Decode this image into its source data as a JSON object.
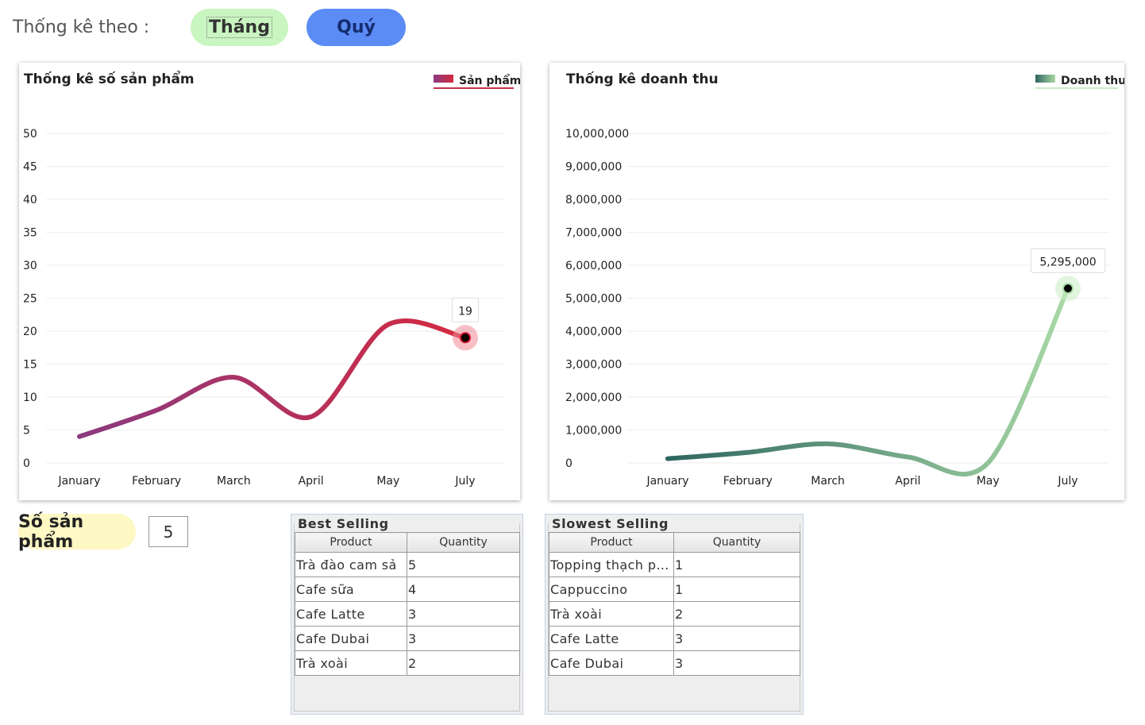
{
  "filter": {
    "label": "Thống kê theo :",
    "month_button": "Tháng",
    "quarter_button": "Quý"
  },
  "colors": {
    "month_button_bg": "#c9f5c0",
    "quarter_button_bg": "#5b8cf5",
    "products_line_start": "#8b3a80",
    "products_line_end": "#d42a40",
    "revenue_line_start": "#2e6660",
    "revenue_line_end": "#a9d9a6",
    "qty_pill_bg": "#fdf8c4"
  },
  "chart_data": [
    {
      "type": "line",
      "title": "Thống kê số sản phẩm",
      "legend": "Sản phẩm",
      "legend_position": "top-right",
      "categories": [
        "January",
        "February",
        "March",
        "April",
        "May",
        "July"
      ],
      "values": [
        4,
        8,
        13,
        7,
        21,
        19
      ],
      "highlight": {
        "index": 5,
        "label": "19"
      },
      "ylim": [
        0,
        50
      ],
      "yticks": [
        0,
        5,
        10,
        15,
        20,
        25,
        30,
        35,
        40,
        45,
        50
      ],
      "ytick_labels": [
        "0",
        "5",
        "10",
        "15",
        "20",
        "25",
        "30",
        "35",
        "40",
        "45",
        "50"
      ],
      "grid": true
    },
    {
      "type": "line",
      "title": "Thống kê doanh thu",
      "legend": "Doanh thu",
      "legend_position": "top-right",
      "categories": [
        "January",
        "February",
        "March",
        "April",
        "May",
        "July"
      ],
      "values": [
        130000,
        320000,
        580000,
        180000,
        0,
        5295000
      ],
      "highlight": {
        "index": 5,
        "label": "5,295,000"
      },
      "ylim": [
        0,
        10000000
      ],
      "yticks": [
        0,
        1000000,
        2000000,
        3000000,
        4000000,
        5000000,
        6000000,
        7000000,
        8000000,
        9000000,
        10000000
      ],
      "ytick_labels": [
        "0",
        "1,000,000",
        "2,000,000",
        "3,000,000",
        "4,000,000",
        "5,000,000",
        "6,000,000",
        "7,000,000",
        "8,000,000",
        "9,000,000",
        "10,000,000"
      ],
      "grid": true
    }
  ],
  "summary": {
    "label": "Số sản phẩm",
    "value": "5"
  },
  "best_selling": {
    "title": "Best Selling",
    "columns": [
      "Product",
      "Quantity"
    ],
    "rows": [
      [
        "Trà đào cam sả",
        "5"
      ],
      [
        "Cafe sữa",
        "4"
      ],
      [
        "Cafe Latte",
        "3"
      ],
      [
        "Cafe Dubai",
        "3"
      ],
      [
        "Trà xoài",
        "2"
      ]
    ]
  },
  "slowest_selling": {
    "title": "Slowest Selling",
    "columns": [
      "Product",
      "Quantity"
    ],
    "rows": [
      [
        "Topping thạch phô mai",
        "1"
      ],
      [
        "Cappuccino",
        "1"
      ],
      [
        "Trà xoài",
        "2"
      ],
      [
        "Cafe Latte",
        "3"
      ],
      [
        "Cafe Dubai",
        "3"
      ]
    ]
  }
}
